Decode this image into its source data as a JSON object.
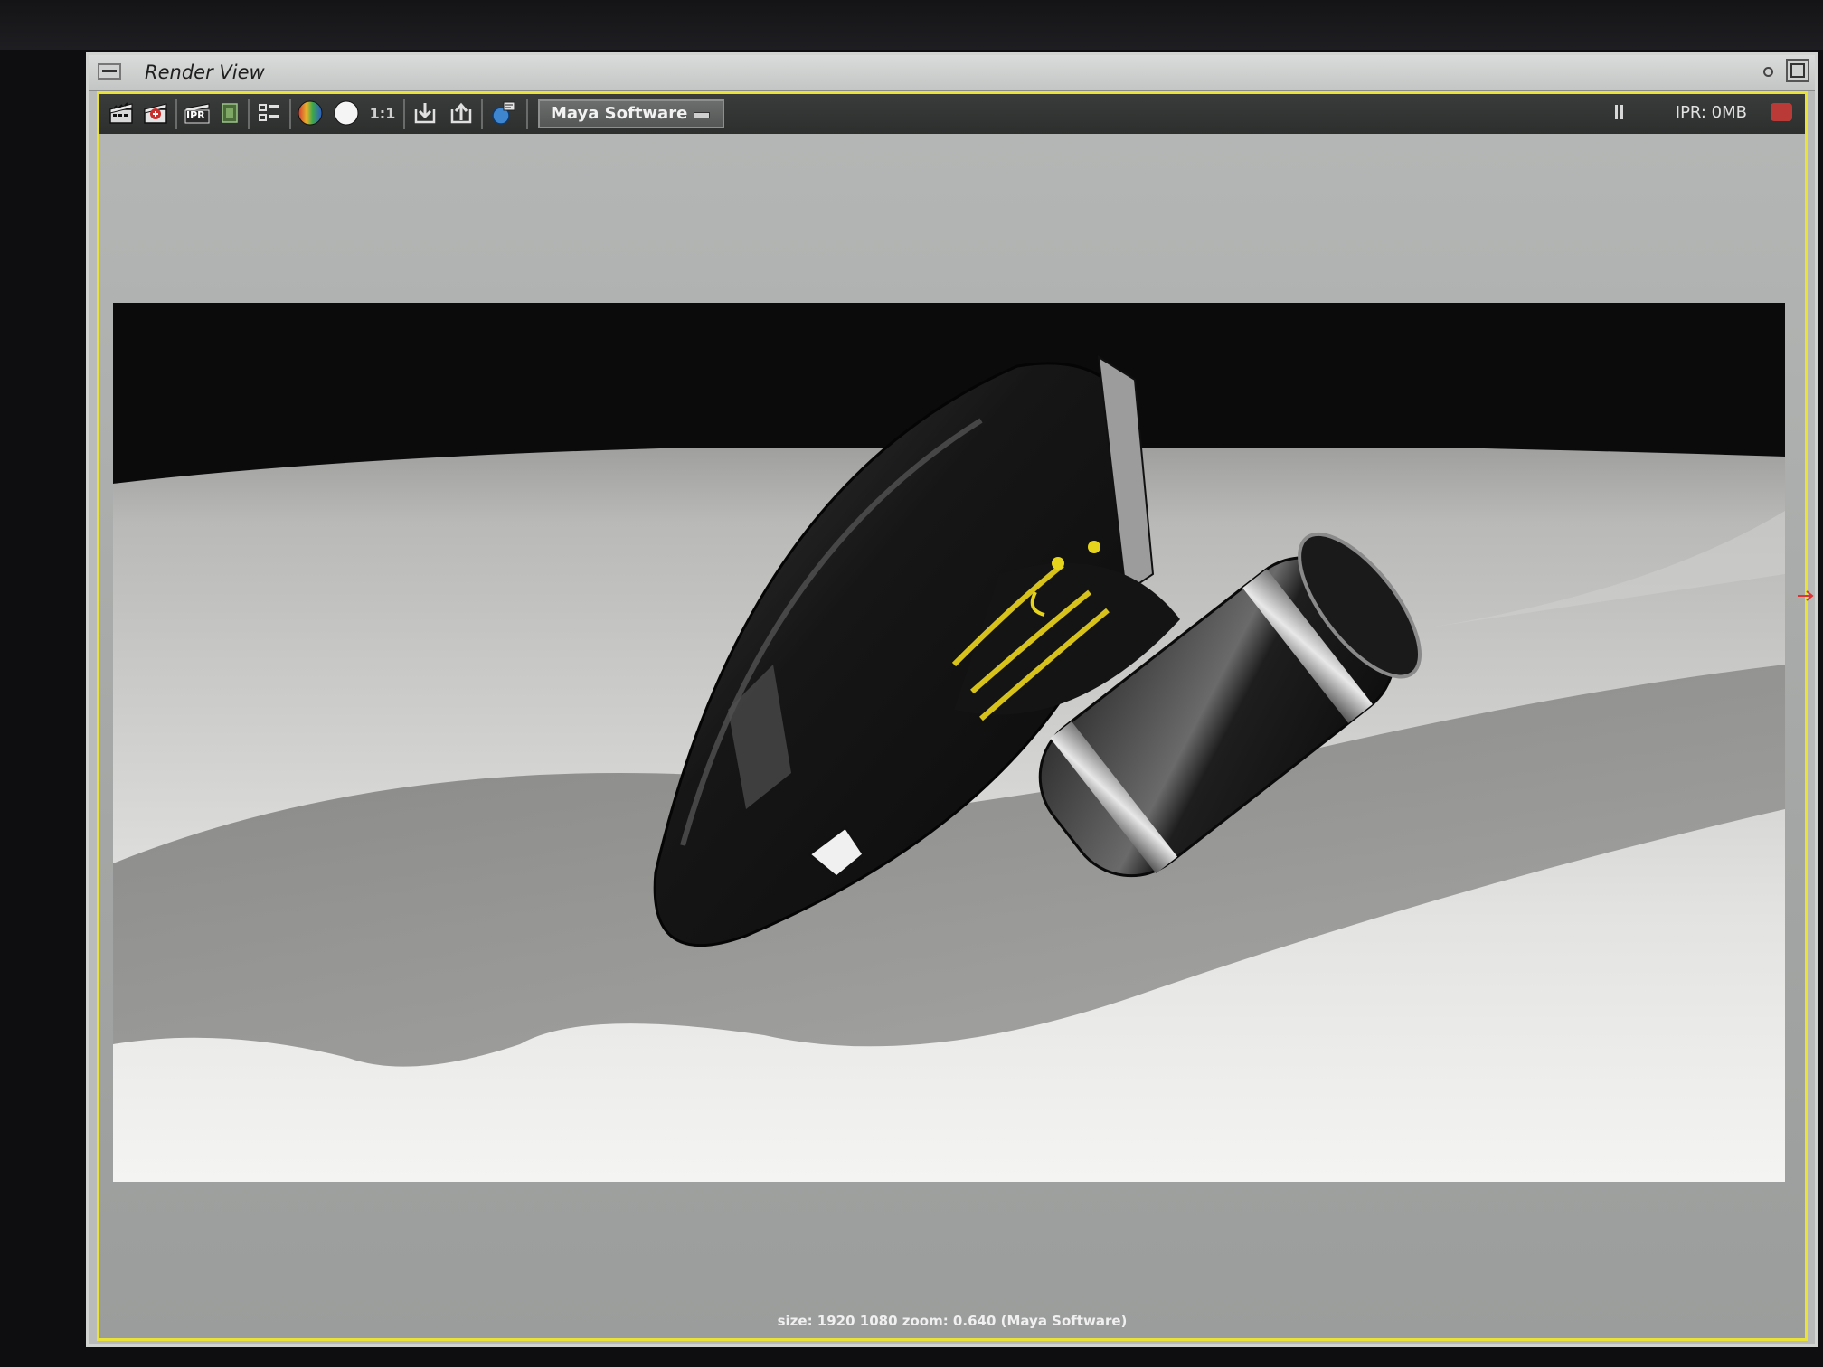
{
  "window": {
    "title": "Render View"
  },
  "toolbar": {
    "icons": [
      "render-frame-icon",
      "redo-render-icon",
      "ipr-render-icon",
      "render-region-icon",
      "snapshot-icon",
      "rgb-channels-icon",
      "alpha-channel-icon",
      "real-size-icon",
      "keep-image-icon",
      "remove-image-icon",
      "render-settings-icon"
    ],
    "ipr_label": "IPR",
    "real_size_label": "1:1",
    "renderer": "Maya Software",
    "ipr_status": "IPR: 0MB"
  },
  "status_bar": {
    "text": "size: 1920 1080 zoom: 0.640  (Maya Software)"
  },
  "colors": {
    "accent_border": "#e8e23a",
    "toolbar_bg": "#2d2f2e",
    "ipr_led": "#b93a36"
  }
}
